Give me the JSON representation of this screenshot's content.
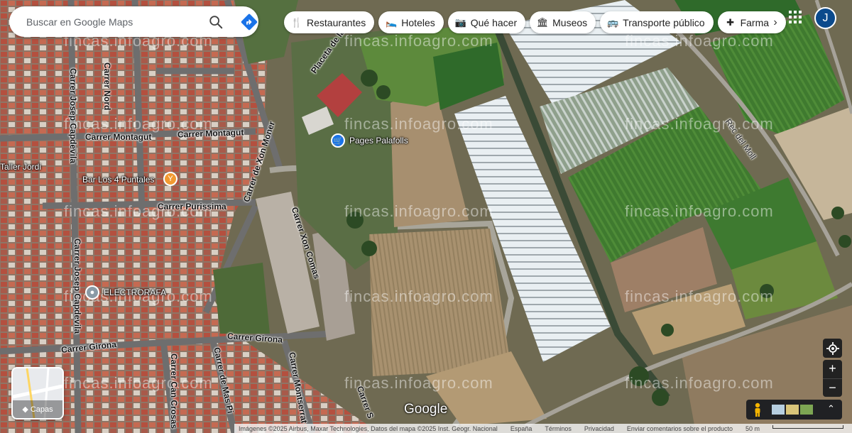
{
  "search": {
    "placeholder": "Buscar en Google Maps"
  },
  "chips": [
    {
      "label": "Restaurantes",
      "icon": "fork-knife-icon"
    },
    {
      "label": "Hoteles",
      "icon": "bed-icon"
    },
    {
      "label": "Qué hacer",
      "icon": "camera-icon"
    },
    {
      "label": "Museos",
      "icon": "museum-icon"
    },
    {
      "label": "Transporte público",
      "icon": "bus-icon"
    },
    {
      "label": "Farma",
      "icon": "pharmacy-icon"
    }
  ],
  "account": {
    "initial": "J",
    "color": "#0b4a8c"
  },
  "streets": {
    "nord": "Carrer Nord",
    "montagut_left": "Carrer Montagut",
    "montagut_right": "Carrer Montagut",
    "capdevila_top": "Carrer Josep Capdevila",
    "capdevila_bottom": "Carrer Josep Capdevila",
    "xon_moner": "Carrer de Xon Moner",
    "purissima": "Carrer Purissima",
    "xon_comas": "Carrer Xon Comas",
    "girona_left": "Carrer Girona",
    "girona_right": "Carrer Girona",
    "can_crosas": "Carrer Can Crosas",
    "mas_pi": "Carrer de Mas Pi",
    "montserrat": "Carrer Montserrat",
    "carrer_s": "Carrer S",
    "placeta": "Placeta de la",
    "rec_del_moll": "Rec del Moll"
  },
  "places": {
    "pages": "Pages Palafolls",
    "bar": "Bar Los 4 Puntales",
    "electrorafa": "ELECTRORAFA",
    "taller": "Taller Jordi"
  },
  "watermark": "fincas.infoagro.com",
  "layers": {
    "label": "Capas"
  },
  "logo": "Google",
  "footer": {
    "imagery": "Imágenes ©2025 Airbus, Maxar Technologies, Datos del mapa ©2025 Inst. Geogr. Nacional",
    "country": "España",
    "terms": "Términos",
    "privacy": "Privacidad",
    "feedback": "Enviar comentarios sobre el producto",
    "scale": "50 m"
  },
  "colors": {
    "urban": "#8a6b5a",
    "roof_red": "#b4503f",
    "field_green": "#3f7a2f",
    "greenhouse": "#e6eef2",
    "soil": "#a89270",
    "direction_blue": "#1a73e8",
    "poi_blue": "#1a73e8",
    "poi_orange": "#f29a31"
  }
}
